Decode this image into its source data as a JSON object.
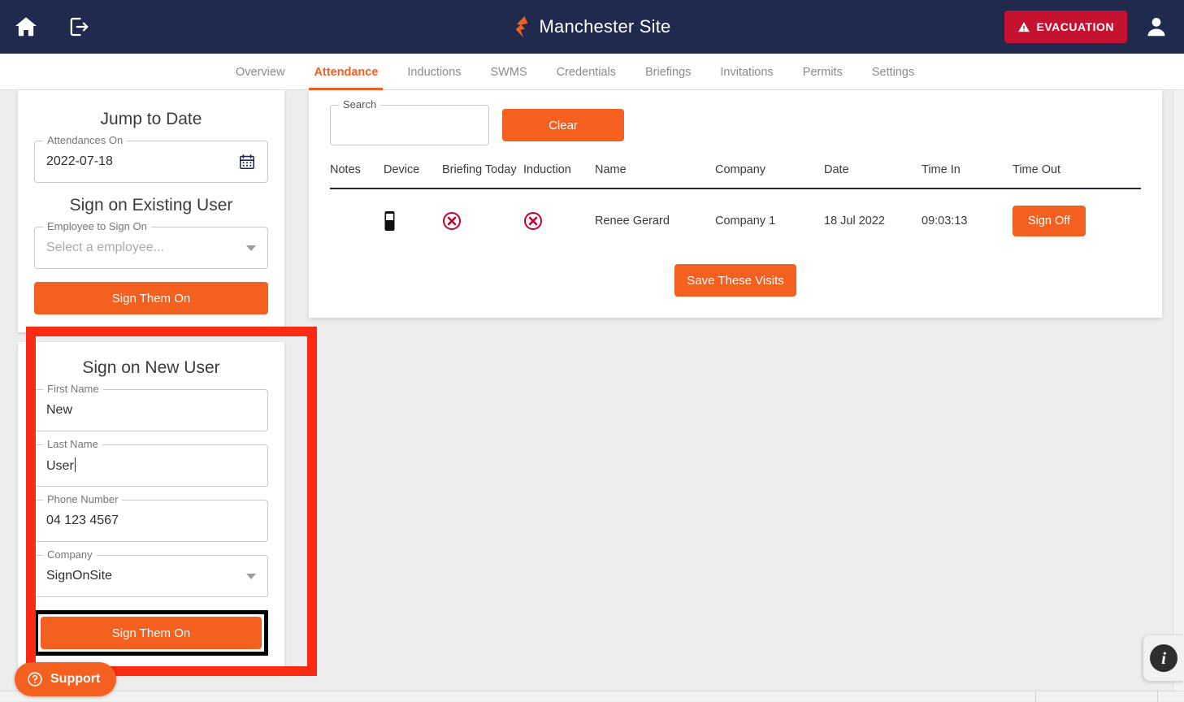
{
  "header": {
    "home_icon": "home-icon",
    "exit_icon": "exit-icon",
    "site_title": "Manchester Site",
    "logo_icon": "signonsite-logo-icon",
    "evacuation_label": "EVACUATION",
    "warning_icon": "warning-triangle-icon",
    "account_icon": "user-account-icon",
    "bg_color": "#1f2a4e",
    "evac_color": "#c41230"
  },
  "nav": {
    "active": "Attendance",
    "accent_color": "#f4601f",
    "tabs": [
      {
        "label": "Overview"
      },
      {
        "label": "Attendance"
      },
      {
        "label": "Inductions"
      },
      {
        "label": "SWMS"
      },
      {
        "label": "Credentials"
      },
      {
        "label": "Briefings"
      },
      {
        "label": "Invitations"
      },
      {
        "label": "Permits"
      },
      {
        "label": "Settings"
      }
    ]
  },
  "sidebar": {
    "jump_to_date": {
      "title": "Jump to Date",
      "field_label": "Attendances On",
      "value": "2022-07-18",
      "calendar_icon": "calendar-icon"
    },
    "sign_existing": {
      "title": "Sign on Existing User",
      "field_label": "Employee to Sign On",
      "placeholder": "Select a employee...",
      "value": "",
      "button_label": "Sign Them On"
    },
    "sign_new": {
      "title": "Sign on New User",
      "fields": [
        {
          "label": "First Name",
          "value": "New",
          "type": "text"
        },
        {
          "label": "Last Name",
          "value": "User",
          "type": "text",
          "focused": true
        },
        {
          "label": "Phone Number",
          "value": "04 123 4567",
          "type": "text"
        },
        {
          "label": "Company",
          "value": "SignOnSite",
          "type": "select"
        }
      ],
      "button_label": "Sign Them On",
      "highlight_color": "#fb2b13"
    }
  },
  "support": {
    "label": "Support",
    "icon": "question-mark-circle-icon"
  },
  "main": {
    "search": {
      "label": "Search",
      "value": "",
      "placeholder": ""
    },
    "clear_label": "Clear",
    "save_visits_label": "Save These Visits",
    "table": {
      "columns": [
        "Notes",
        "Device",
        "Briefing Today",
        "Induction",
        "Name",
        "Company",
        "Date",
        "Time In",
        "Time Out"
      ],
      "rows": [
        {
          "notes": "",
          "device_icon": "mobile-phone-icon",
          "briefing_today_icon": "red-cross-circle-icon",
          "induction_icon": "red-cross-circle-icon",
          "name": "Renee Gerard",
          "company": "Company 1",
          "date": "18 Jul 2022",
          "time_in": "09:03:13",
          "time_out_action": "Sign Off"
        }
      ]
    }
  },
  "info_fab": {
    "icon": "info-icon",
    "glyph": "i"
  }
}
